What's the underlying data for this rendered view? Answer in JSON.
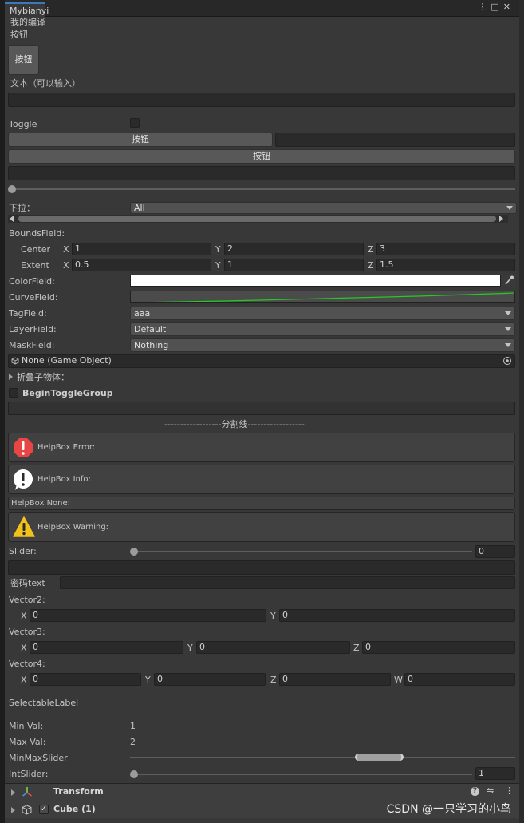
{
  "window": {
    "tab_title": "Mybianyi",
    "menu_label": "⋮",
    "maximize_label": "□",
    "close_label": "✕"
  },
  "header": {
    "subtitle": "我的编译",
    "section_label": "按钮"
  },
  "fields": {
    "square_button": "按钮",
    "text_label": "文本（可以输入）",
    "text_value": "",
    "toggle_label": "Toggle",
    "button_left": "按钮",
    "button_wide": "按钮",
    "dropdown_label": "下拉：",
    "dropdown_value": "All",
    "bounds_label": "BoundsField:",
    "center_label": "Center",
    "extent_label": "Extent",
    "center": {
      "x": "1",
      "y": "2",
      "z": "3"
    },
    "extent": {
      "x": "0.5",
      "y": "1",
      "z": "1.5"
    },
    "color_label": "ColorField:",
    "color_value": "#ffffff",
    "curve_label": "CurveField:",
    "tag_label": "TagField:",
    "tag_value": "aaa",
    "layer_label": "LayerField:",
    "layer_value": "Default",
    "mask_label": "MaskField:",
    "mask_value": "Nothing",
    "object_value": "None (Game Object)",
    "foldout_label": "折叠子物体：",
    "toggle_group_label": "BeginToggleGroup",
    "separator": "------------------分割线------------------",
    "help_error": "HelpBox Error:",
    "help_info": "HelpBox Info:",
    "help_none": "HelpBox None:",
    "help_warning": "HelpBox Warning:",
    "slider_label": "Slider:",
    "slider_value": "0",
    "slider_fraction": 0,
    "password_label": "密码text",
    "vector2_label": "Vector2:",
    "vector2": {
      "x": "0",
      "y": "0"
    },
    "vector3_label": "Vector3:",
    "vector3": {
      "x": "0",
      "y": "0",
      "z": "0"
    },
    "vector4_label": "Vector4:",
    "vector4": {
      "x": "0",
      "y": "0",
      "z": "0",
      "w": "0"
    },
    "selectable_label": "SelectableLabel",
    "min_val_label": "Min Val:",
    "min_val": "1",
    "max_val_label": "Max Val:",
    "max_val": "2",
    "minmax_label": "MinMaxSlider",
    "intslider_label": "IntSlider:",
    "intslider_value": "1",
    "axis": {
      "x": "X",
      "y": "Y",
      "z": "Z",
      "w": "W"
    }
  },
  "components": [
    {
      "name": "Transform"
    },
    {
      "name": "Cube (1)"
    }
  ],
  "colors": {
    "error": "#e84545",
    "warning": "#f1c21b",
    "curve": "#22cc22",
    "tab_accent": "#3a79bb"
  },
  "watermark": "CSDN @一只学习的小鸟"
}
